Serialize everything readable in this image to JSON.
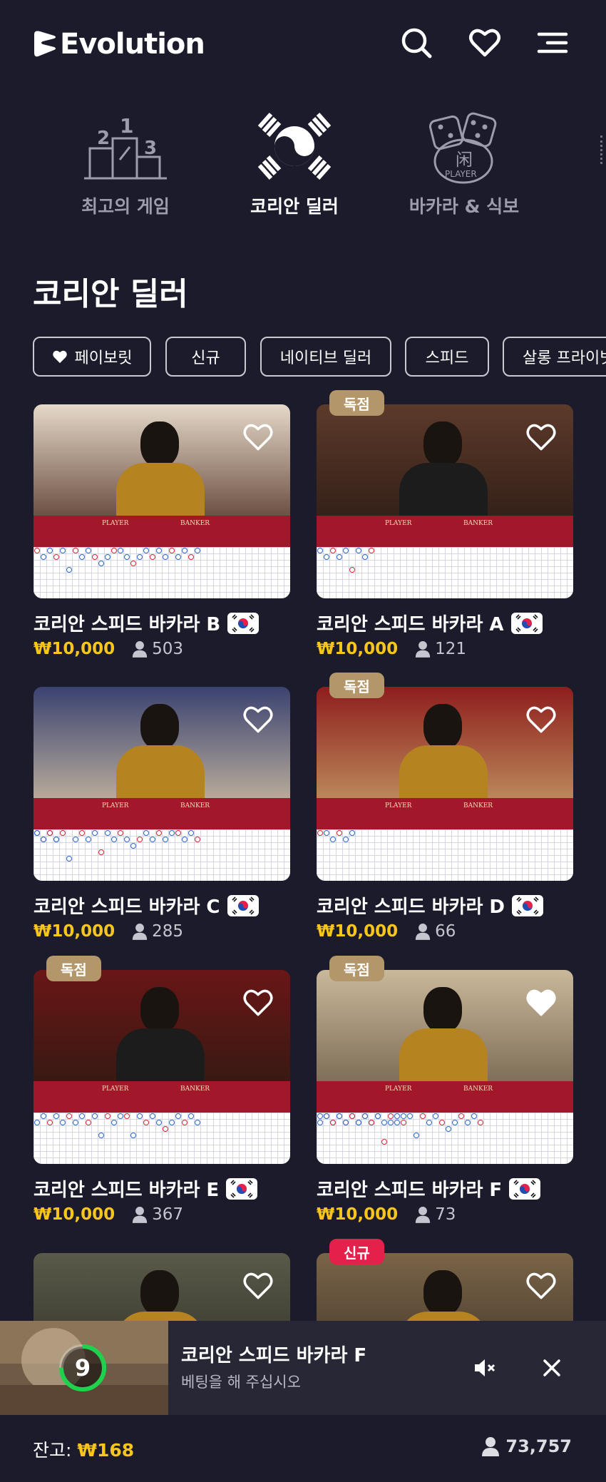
{
  "header": {
    "brand": "Evolution",
    "icons": [
      "search-icon",
      "heart-icon",
      "menu-icon"
    ]
  },
  "categories": [
    {
      "label": "최고의 게임",
      "icon": "podium-icon",
      "active": false
    },
    {
      "label": "코리안 딜러",
      "icon": "korea-flag-icon",
      "active": true
    },
    {
      "label": "바카라 & 식보",
      "icon": "dice-icon",
      "active": false,
      "icon_text": [
        "闲",
        "PLAYER"
      ]
    }
  ],
  "section_title": "코리안 딜러",
  "filters": [
    {
      "label": "페이보릿",
      "icon": "heart-icon"
    },
    {
      "label": "신규"
    },
    {
      "label": "네이티브 딜러"
    },
    {
      "label": "스피드"
    },
    {
      "label": "살롱 프라이빗"
    }
  ],
  "games": [
    {
      "title": "코리안 스피드 바카라 B",
      "price": "₩10,000",
      "players": "503",
      "badge": "",
      "favorited": false
    },
    {
      "title": "코리안 스피드 바카라 A",
      "price": "₩10,000",
      "players": "121",
      "badge": "독점",
      "favorited": false
    },
    {
      "title": "코리안 스피드 바카라 C",
      "price": "₩10,000",
      "players": "285",
      "badge": "",
      "favorited": false
    },
    {
      "title": "코리안 스피드 바카라 D",
      "price": "₩10,000",
      "players": "66",
      "badge": "독점",
      "favorited": false
    },
    {
      "title": "코리안 스피드 바카라 E",
      "price": "₩10,000",
      "players": "367",
      "badge": "독점",
      "favorited": false
    },
    {
      "title": "코리안 스피드 바카라 F",
      "price": "₩10,000",
      "players": "73",
      "badge": "독점",
      "favorited": true
    },
    {
      "title": "",
      "price": "",
      "players": "",
      "badge": "",
      "favorited": false
    },
    {
      "title": "",
      "price": "",
      "players": "",
      "badge": "신규",
      "favorited": false
    }
  ],
  "table_labels": {
    "player": "PLAYER",
    "banker": "BANKER"
  },
  "colors": {
    "background": "#1b1b2b",
    "gold": "#f7c51b",
    "badge_exclusive": "#b3976a",
    "badge_new": "#e3214b",
    "timer_green": "#1dd34d",
    "road_blue": "#2a66c9",
    "road_red": "#d42634"
  },
  "mini_player": {
    "timer": "9",
    "timer_fraction": 0.75,
    "title": "코리안 스피드 바카라 F",
    "subtitle": "베팅을 해 주십시오",
    "icons": [
      "mute-icon",
      "close-icon"
    ]
  },
  "footer": {
    "balance_label": "잔고:",
    "balance_value": "₩168",
    "online_count": "73,757"
  }
}
